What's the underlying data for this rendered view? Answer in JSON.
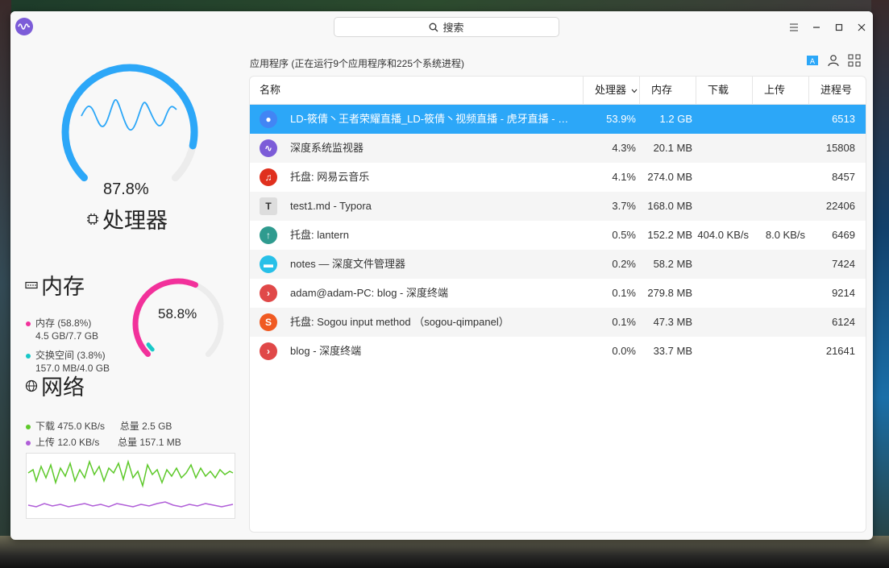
{
  "app": {
    "search_placeholder": "搜索"
  },
  "cpu": {
    "percent": "87.8%",
    "title": "处理器",
    "usage": 0.878
  },
  "memory": {
    "title": "内存",
    "percent": "58.8%",
    "mem_label": "内存 (58.8%)",
    "mem_detail": "4.5 GB/7.7 GB",
    "swap_label": "交换空间 (3.8%)",
    "swap_detail": "157.0 MB/4.0 GB",
    "usage": 0.588,
    "swap_usage": 0.038,
    "colors": {
      "memory": "#f2319b",
      "swap": "#18c8c8"
    }
  },
  "network": {
    "title": "网络",
    "download": "下载 475.0 KB/s",
    "download_total": "总量 2.5 GB",
    "upload": "上传 12.0 KB/s",
    "upload_total": "总量 157.1 MB",
    "colors": {
      "download": "#5ec92b",
      "upload": "#b05ed8"
    }
  },
  "process_list": {
    "summary": "应用程序 (正在运行9个应用程序和225个系统进程)",
    "columns": {
      "name": "名称",
      "cpu": "处理器",
      "memory": "内存",
      "download": "下载",
      "upload": "上传",
      "pid": "进程号"
    },
    "rows": [
      {
        "name": "LD-筱倩丶王者荣耀直播_LD-筱倩丶视频直播 - 虎牙直播 - …",
        "cpu": "53.9%",
        "memory": "1.2 GB",
        "download": "",
        "upload": "",
        "pid": "6513",
        "icon": "chrome-icon",
        "color": "#4285f4",
        "glyph": "●"
      },
      {
        "name": "深度系统监视器",
        "cpu": "4.3%",
        "memory": "20.1 MB",
        "download": "",
        "upload": "",
        "pid": "15808",
        "icon": "system-monitor-icon",
        "color": "#7c5cd8",
        "glyph": "∿"
      },
      {
        "name": "托盘: 网易云音乐",
        "cpu": "4.1%",
        "memory": "274.0 MB",
        "download": "",
        "upload": "",
        "pid": "8457",
        "icon": "netease-music-icon",
        "color": "#e0301e",
        "glyph": "♫"
      },
      {
        "name": "test1.md - Typora",
        "cpu": "3.7%",
        "memory": "168.0 MB",
        "download": "",
        "upload": "",
        "pid": "22406",
        "icon": "typora-icon",
        "color": "#dddddd",
        "glyph": "T"
      },
      {
        "name": "托盘: lantern",
        "cpu": "0.5%",
        "memory": "152.2 MB",
        "download": "404.0 KB/s",
        "upload": "8.0 KB/s",
        "pid": "6469",
        "icon": "lantern-icon",
        "color": "#2f9b8f",
        "glyph": "↑"
      },
      {
        "name": "notes — 深度文件管理器",
        "cpu": "0.2%",
        "memory": "58.2 MB",
        "download": "",
        "upload": "",
        "pid": "7424",
        "icon": "file-manager-icon",
        "color": "#27c0e8",
        "glyph": "▬"
      },
      {
        "name": "adam@adam-PC: blog - 深度终端",
        "cpu": "0.1%",
        "memory": "279.8 MB",
        "download": "",
        "upload": "",
        "pid": "9214",
        "icon": "terminal-icon",
        "color": "#e04848",
        "glyph": "›"
      },
      {
        "name": "托盘: Sogou input method （sogou-qimpanel）",
        "cpu": "0.1%",
        "memory": "47.3 MB",
        "download": "",
        "upload": "",
        "pid": "6124",
        "icon": "sogou-icon",
        "color": "#f05a22",
        "glyph": "S"
      },
      {
        "name": "blog - 深度终端",
        "cpu": "0.0%",
        "memory": "33.7 MB",
        "download": "",
        "upload": "",
        "pid": "21641",
        "icon": "terminal-icon",
        "color": "#e04848",
        "glyph": "›"
      }
    ]
  }
}
